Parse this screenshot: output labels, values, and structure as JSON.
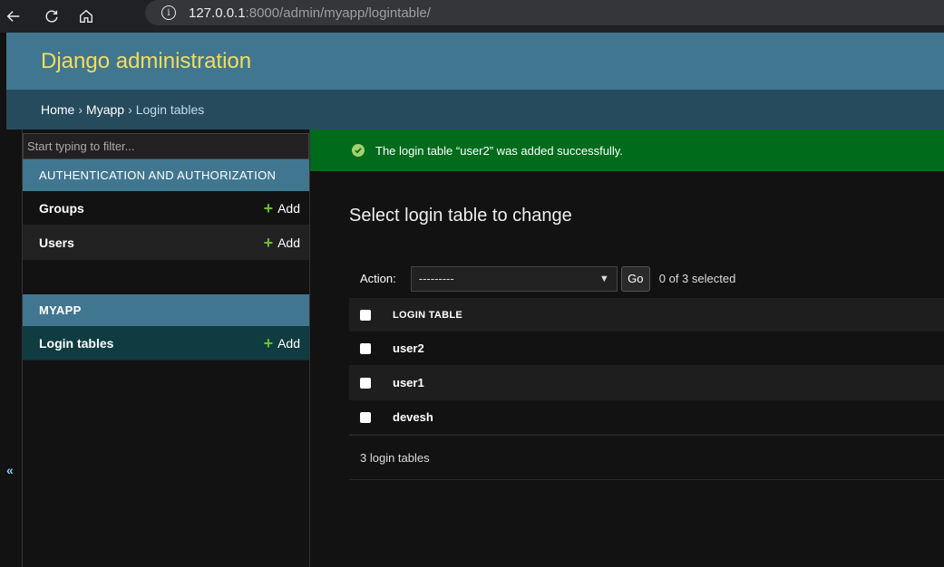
{
  "browser": {
    "url_host": "127.0.0.1",
    "url_path": ":8000/admin/myapp/logintable/"
  },
  "header": {
    "branding": "Django administration"
  },
  "breadcrumbs": {
    "home": "Home",
    "app": "Myapp",
    "current": "Login tables",
    "sep": "›"
  },
  "sidebar": {
    "filter_placeholder": "Start typing to filter...",
    "toggle": "«",
    "apps": [
      {
        "caption": "AUTHENTICATION AND AUTHORIZATION",
        "models": [
          {
            "name": "Groups",
            "add": "Add"
          },
          {
            "name": "Users",
            "add": "Add"
          }
        ]
      },
      {
        "caption": "MYAPP",
        "models": [
          {
            "name": "Login tables",
            "add": "Add"
          }
        ]
      }
    ]
  },
  "message": {
    "text": "The login table “user2” was added successfully."
  },
  "content": {
    "title": "Select login table to change",
    "action_label": "Action:",
    "action_value": "---------",
    "go_label": "Go",
    "selected": "0 of 3 selected",
    "column_header": "LOGIN TABLE",
    "rows": [
      "user2",
      "user1",
      "devesh"
    ],
    "paginator": "3 login tables"
  },
  "colors": {
    "header_bg": "#417690",
    "branding": "#f5dd5d",
    "breadcrumbs_bg": "#264b5d",
    "success_bg": "#006b1b",
    "add_plus": "#70bf2b"
  }
}
